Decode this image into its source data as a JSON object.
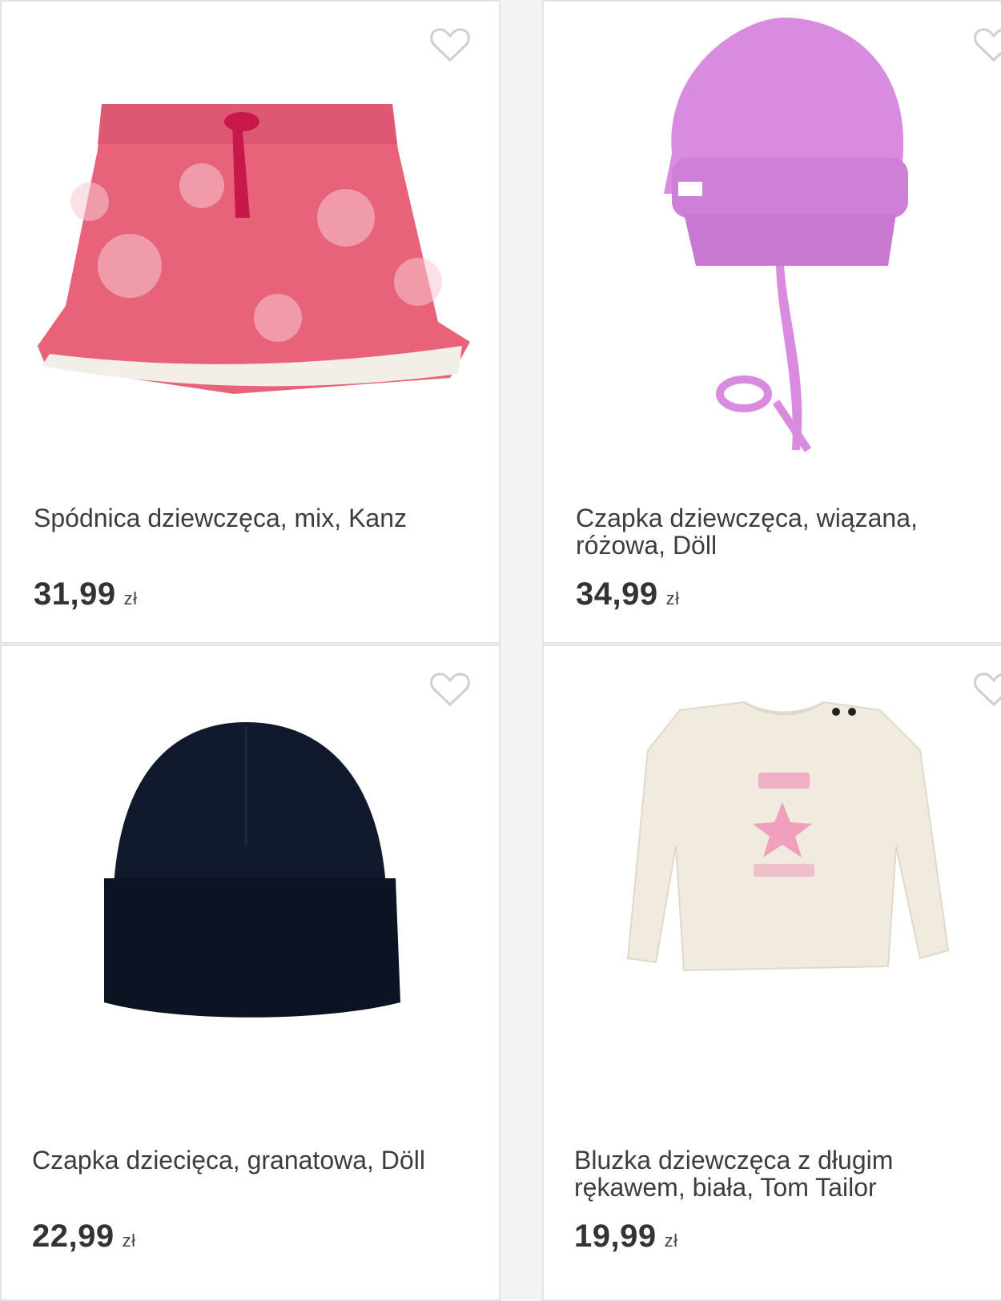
{
  "products": [
    {
      "name": "Spódnica dziewczęca, mix, Kanz",
      "price": "31,99",
      "currency": "zł",
      "favorite_icon": "heart-outline-icon"
    },
    {
      "name": "Czapka dziewczęca, wiązana, różowa, Döll",
      "price": "34,99",
      "currency": "zł",
      "favorite_icon": "heart-outline-icon"
    },
    {
      "name": "Czapka dziecięca, granatowa, Döll",
      "price": "22,99",
      "currency": "zł",
      "favorite_icon": "heart-outline-icon"
    },
    {
      "name": "Bluzka dziewczęca z długim rękawem, biała, Tom Tailor",
      "price": "19,99",
      "currency": "zł",
      "favorite_icon": "heart-outline-icon"
    }
  ],
  "colors": {
    "skirt": "#e8637a",
    "hat_pink": "#d98be0",
    "hat_navy": "#111a2c",
    "shirt": "#f1ebdf",
    "star_pink": "#f0a0bd"
  }
}
